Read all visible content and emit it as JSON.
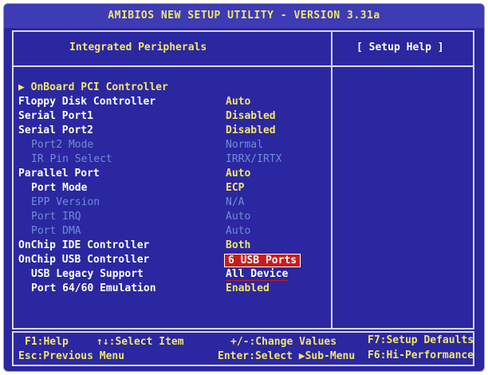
{
  "window": {
    "title": "AMIBIOS NEW SETUP UTILITY - VERSION 3.31a"
  },
  "panel": {
    "section_title": "Integrated Peripherals",
    "help_title": "[ Setup Help ]"
  },
  "items": [
    {
      "label": "▶ OnBoard PCI Controller",
      "value": ""
    },
    {
      "label": "Floppy Disk Controller",
      "value": "Auto"
    },
    {
      "label": "Serial Port1",
      "value": "Disabled"
    },
    {
      "label": "Serial Port2",
      "value": "Disabled"
    },
    {
      "label": "Port2 Mode",
      "value": "Normal"
    },
    {
      "label": "IR Pin Select",
      "value": "IRRX/IRTX"
    },
    {
      "label": "Parallel Port",
      "value": "Auto"
    },
    {
      "label": "Port Mode",
      "value": "ECP"
    },
    {
      "label": "EPP Version",
      "value": "N/A"
    },
    {
      "label": "Port IRQ",
      "value": "Auto"
    },
    {
      "label": "Port DMA",
      "value": "Auto"
    },
    {
      "label": "OnChip IDE Controller",
      "value": "Both"
    },
    {
      "label": "OnChip USB Controller",
      "value": "6 USB Ports"
    },
    {
      "label": "USB Legacy Support",
      "value": "All Device"
    },
    {
      "label": "Port 64/60 Emulation",
      "value": "Enabled"
    }
  ],
  "footer": {
    "help": "F1:Help",
    "select_item": "↑↓:Select Item",
    "change_values": "+/-:Change Values",
    "setup_defaults": "F7:Setup Defaults",
    "previous_menu": "Esc:Previous Menu",
    "select_submenu": "Enter:Select ▶Sub-Menu",
    "hi_performance": "F6:Hi-Performance"
  },
  "colors": {
    "background": "#2b27a0",
    "text_yellow": "#f2e66a",
    "text_white": "#ffffff",
    "text_disabled": "#6e8ed6",
    "selection_red": "#cc1a1a"
  }
}
